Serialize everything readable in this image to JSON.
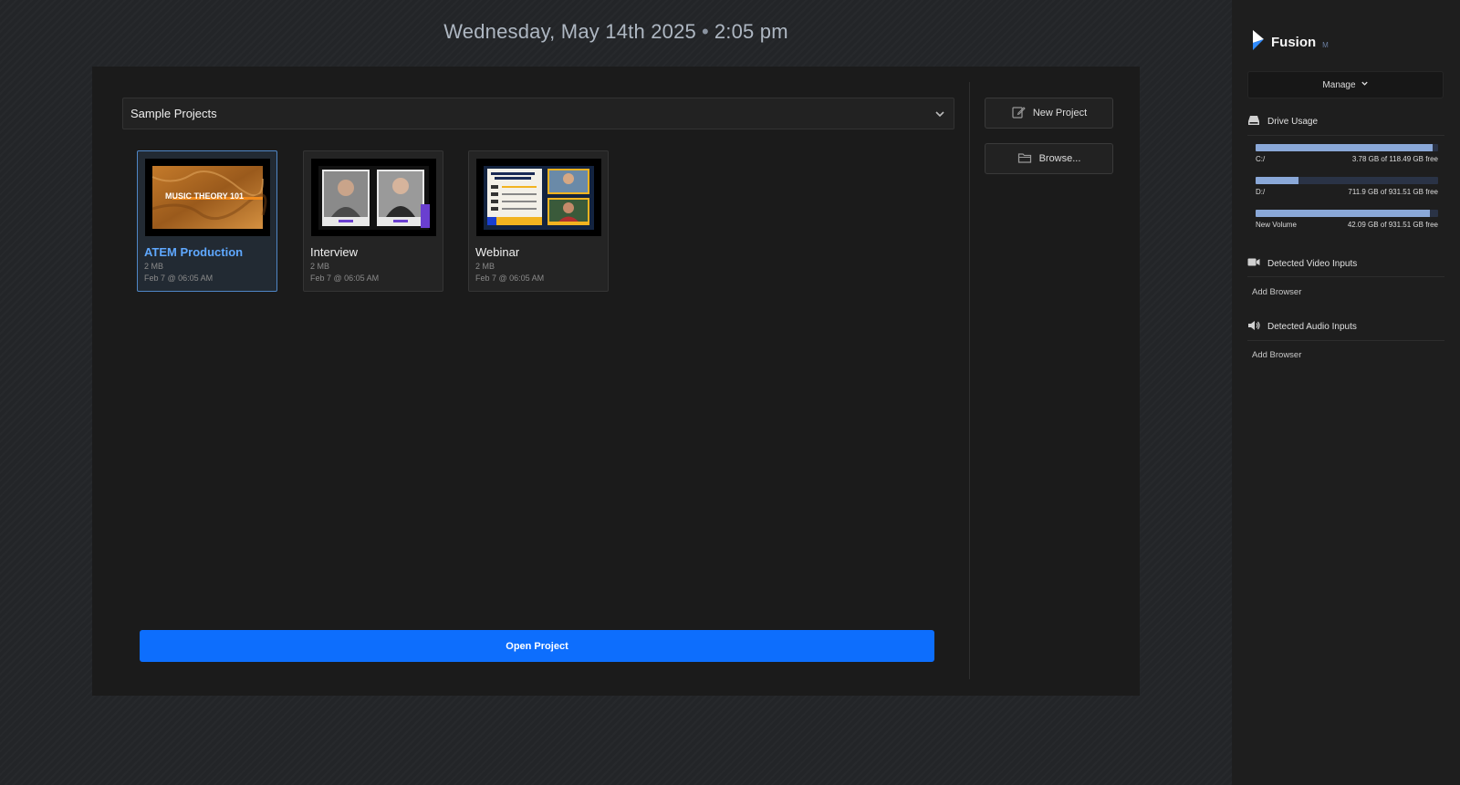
{
  "header": {
    "date": "Wednesday, May 14th 2025",
    "separator": "•",
    "time": "2:05 pm"
  },
  "project_select": {
    "value": "Sample Projects",
    "icon": "chevron-down-icon"
  },
  "projects": [
    {
      "title": "ATEM Production",
      "size": "2 MB",
      "date": "Feb 7 @ 06:05 AM",
      "selected": true,
      "thumb_text": "MUSIC THEORY 101"
    },
    {
      "title": "Interview",
      "size": "2 MB",
      "date": "Feb 7 @ 06:05 AM",
      "selected": false
    },
    {
      "title": "Webinar",
      "size": "2 MB",
      "date": "Feb 7 @ 06:05 AM",
      "selected": false
    }
  ],
  "actions": {
    "new_project": "New Project",
    "browse": "Browse...",
    "open_project": "Open Project"
  },
  "sidebar": {
    "brand": "Fusion",
    "brand_tag": "M",
    "manage": "Manage",
    "drive_usage": {
      "heading": "Drive Usage",
      "drives": [
        {
          "name": "C:/",
          "free_text": "3.78 GB of 118.49 GB free",
          "used_fraction": 0.968
        },
        {
          "name": "D:/",
          "free_text": "711.9 GB of 931.51 GB free",
          "used_fraction": 0.236
        },
        {
          "name": "New Volume",
          "free_text": "42.09 GB of 931.51 GB free",
          "used_fraction": 0.955
        }
      ]
    },
    "video_inputs": {
      "heading": "Detected Video Inputs",
      "add_label": "Add Browser"
    },
    "audio_inputs": {
      "heading": "Detected Audio Inputs",
      "add_label": "Add Browser"
    }
  },
  "colors": {
    "accent": "#0d6efd",
    "selected_title": "#5fa8ff",
    "drive_fill": "#8aa8d8"
  }
}
